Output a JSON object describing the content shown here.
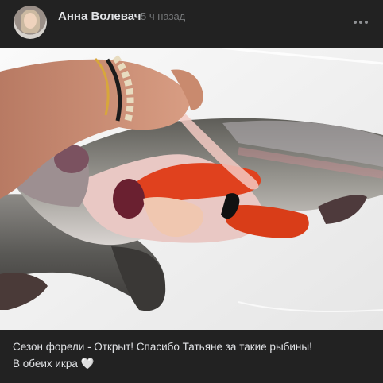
{
  "post": {
    "author_name": "Анна Волевач",
    "time": "5 ч назад",
    "caption_line1": "Сезон форели - Открыт! Спасибо Татьяне за такие рыбины!",
    "caption_line2": "В обеих икра",
    "heart": "🤍"
  },
  "icons": {
    "more": "more-dots-icon",
    "avatar": "user-avatar"
  },
  "colors": {
    "background": "#222222",
    "text": "#e1e3e6",
    "secondary_text": "#76787a"
  }
}
